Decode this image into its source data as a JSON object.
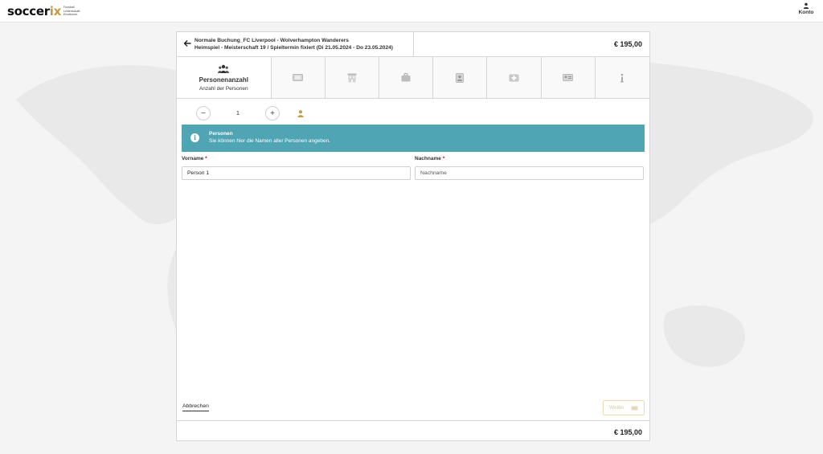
{
  "header": {
    "logo_main": "soccer",
    "logo_accent": "ix",
    "logo_tagline": [
      "Fussball.",
      "Leidenschaft.",
      "Emotionen."
    ],
    "account_label": "Konto",
    "accent_color": "#c89a44"
  },
  "booking": {
    "title_line1": "Normale Buchung_FC Liverpool - Wolverhampton Wanderers",
    "title_line2": "Heimspiel - Meisterschaft 19 / Spieltermin fixiert (Di 21.05.2024 - Do 23.05.2024)",
    "price": "€ 195,00"
  },
  "steps": {
    "active": {
      "title": "Personenanzahl",
      "subtitle": "Anzahl der Personen",
      "icon": "people-group-icon"
    },
    "others": [
      {
        "icon": "ticket-icon"
      },
      {
        "icon": "hotel-building-icon"
      },
      {
        "icon": "luggage-icon"
      },
      {
        "icon": "id-portrait-icon"
      },
      {
        "icon": "medical-kit-icon"
      },
      {
        "icon": "id-card-icon"
      },
      {
        "icon": "info-icon"
      }
    ]
  },
  "counter": {
    "minus_label": "−",
    "plus_label": "+",
    "value": "1",
    "person_icon_color": "#c89a44"
  },
  "info": {
    "title": "Personen",
    "text": "Sie können hier die Namen aller Personen angeben.",
    "icon_label": "i",
    "color": "#4fa5b3"
  },
  "form": {
    "firstname_label": "Vorname",
    "firstname_value": "Person 1",
    "lastname_label": "Nachname",
    "lastname_placeholder": "Nachname",
    "required_mark": "*"
  },
  "actions": {
    "cancel_label": "Abbrechen",
    "next_label": "Weiter"
  },
  "footer": {
    "price": "€ 195,00"
  }
}
